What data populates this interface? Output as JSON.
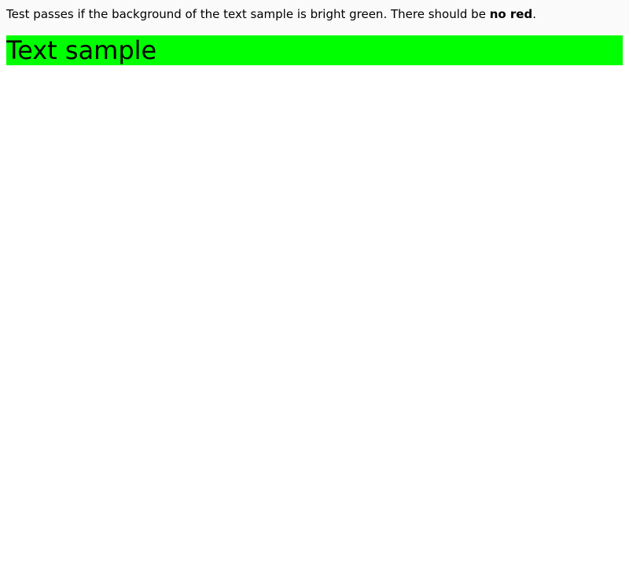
{
  "instructions": {
    "prefix": "Test passes if the background of the text sample is bright green. There should be ",
    "emphasis": "no red",
    "suffix": "."
  },
  "sample": {
    "text": "Text sample",
    "background_color": "#00ff00"
  },
  "colors": {
    "instructions_background": "#fafafa",
    "page_background": "#ffffff",
    "text": "#000000"
  }
}
